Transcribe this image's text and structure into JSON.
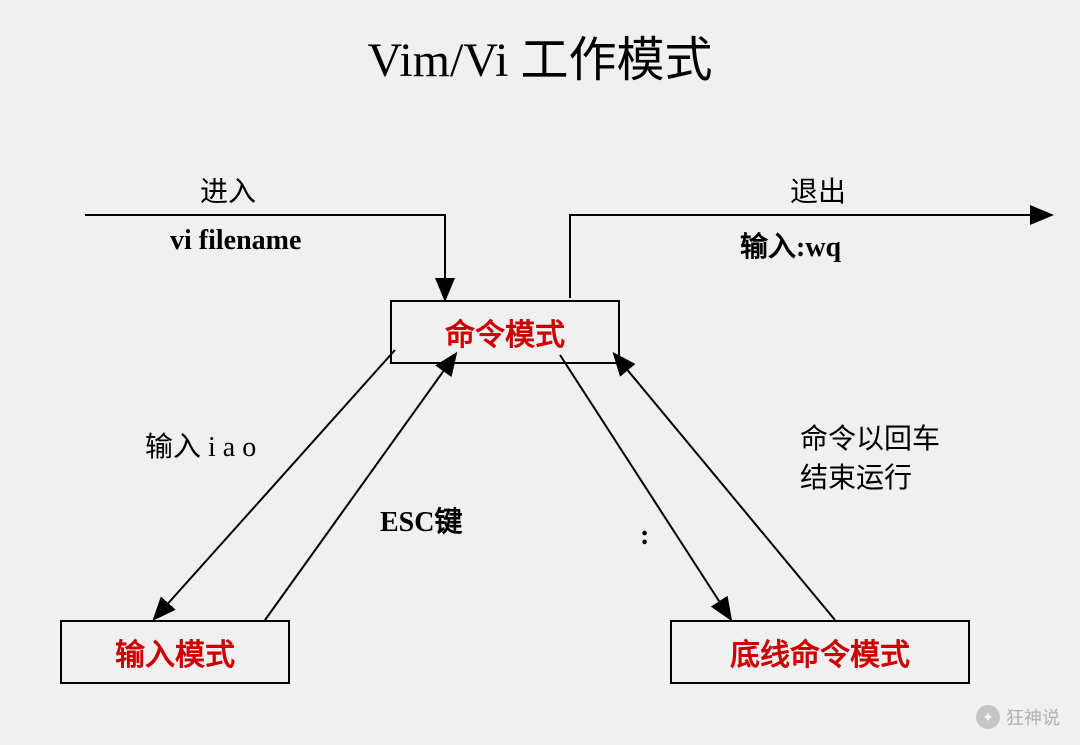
{
  "title": "Vim/Vi 工作模式",
  "nodes": {
    "command": "命令模式",
    "input": "输入模式",
    "bottom": "底线命令模式"
  },
  "labels": {
    "enter": "进入",
    "vi_filename": "vi filename",
    "exit": "退出",
    "wq": "输入:wq",
    "iao": "输入 i a o",
    "esc": "ESC键",
    "colon": ":",
    "enter_end_1": "命令以回车",
    "enter_end_2": "结束运行"
  },
  "watermark": {
    "text": "狂神说"
  }
}
